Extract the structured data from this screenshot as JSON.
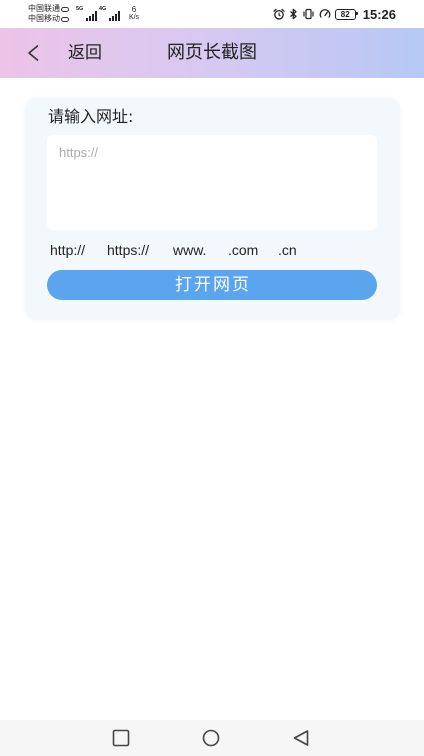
{
  "status_bar": {
    "carriers": [
      "中国联通",
      "中国移动"
    ],
    "networks": [
      "5G",
      "4G"
    ],
    "net_speed_value": "6",
    "net_speed_unit": "K/s",
    "icons": [
      "hd-call-icon",
      "signal-strength-icon",
      "alarm-icon",
      "bluetooth-icon",
      "vibrate-icon",
      "gauge-icon",
      "battery-icon"
    ],
    "battery_level": "82",
    "time": "15:26"
  },
  "header": {
    "back_icon": "chevron-left-icon",
    "back_label": "返回",
    "title": "网页长截图"
  },
  "url_form": {
    "label": "请输入网址:",
    "input_value": "",
    "input_placeholder": "https://",
    "shortcuts": [
      "http://",
      "https://",
      "www.",
      ".com",
      ".cn"
    ],
    "submit_label": "打开网页"
  },
  "nav_bar": {
    "icons": [
      "recent-apps-square-icon",
      "home-circle-icon",
      "back-triangle-icon"
    ]
  },
  "colors": {
    "header_gradient_start": "#ecc4e7",
    "header_gradient_mid": "#d6c9f1",
    "header_gradient_end": "#b6c8f4",
    "card_bg": "#f3f8fd",
    "button_bg": "#5aa5ee",
    "button_text": "#ffffff",
    "placeholder_text": "#ababab"
  }
}
